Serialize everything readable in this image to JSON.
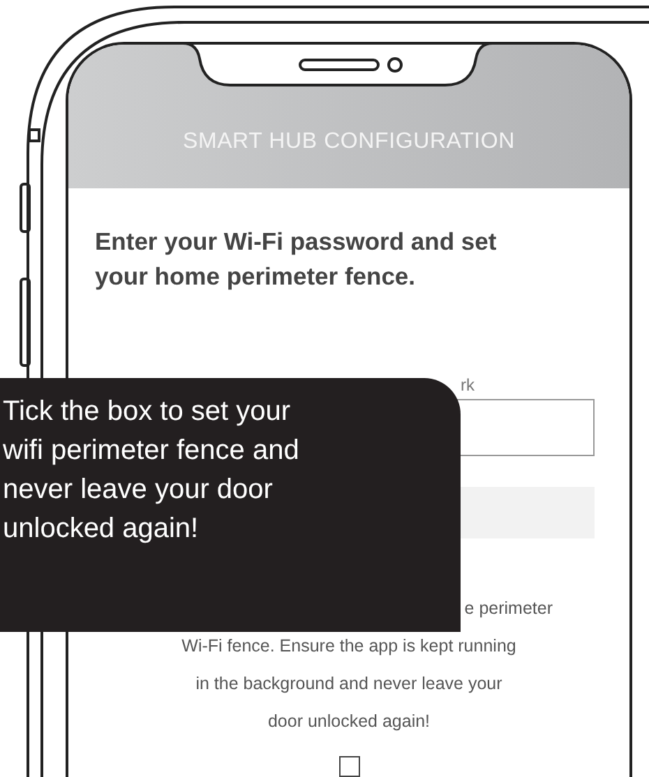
{
  "header": {
    "title": "SMART HUB CONFIGURATION"
  },
  "heading_lines": [
    "Enter your Wi-Fi password and set",
    "your home perimeter fence."
  ],
  "network_label": "rk",
  "fields": [
    {
      "kind": "text"
    },
    {
      "kind": "shaded"
    }
  ],
  "description_lines": [
    "e perimeter",
    "Wi-Fi fence. Ensure the app is kept running",
    "in the background and never leave your",
    "door unlocked again!"
  ],
  "fence_checkbox": {
    "checked": false
  },
  "tooltip": {
    "lines": [
      "Tick the box to set your",
      "wifi perimeter fence and",
      "never leave your door",
      "unlocked again!"
    ]
  }
}
